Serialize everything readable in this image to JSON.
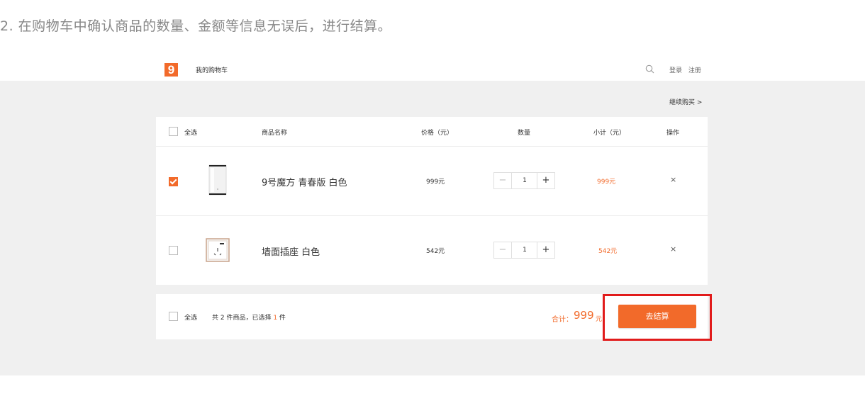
{
  "instruction": "2. 在购物车中确认商品的数量、金额等信息无误后，进行结算。",
  "header": {
    "logo_text": "9",
    "title": "我的购物车",
    "login": "登录",
    "register": "注册"
  },
  "continue_shopping": "继续购买 >",
  "table": {
    "headers": {
      "select_all": "全选",
      "name": "商品名称",
      "price": "价格（元）",
      "quantity": "数量",
      "subtotal": "小计（元）",
      "action": "操作"
    },
    "rows": [
      {
        "checked": true,
        "name": "9号魔方 青春版 白色",
        "price": "999元",
        "quantity": "1",
        "subtotal": "999元",
        "remove": "×"
      },
      {
        "checked": false,
        "name": "墙面插座 白色",
        "price": "542元",
        "quantity": "1",
        "subtotal": "542元",
        "remove": "×"
      }
    ]
  },
  "footer": {
    "select_all": "全选",
    "summary_prefix": "共 2 件商品，已选择 ",
    "selected_count": "1",
    "summary_suffix": " 件",
    "total_label": "合计：",
    "total_value": "999",
    "total_unit": "元",
    "checkout": "去结算"
  },
  "colors": {
    "accent": "#f26a2a",
    "highlight": "#e11b1b"
  }
}
